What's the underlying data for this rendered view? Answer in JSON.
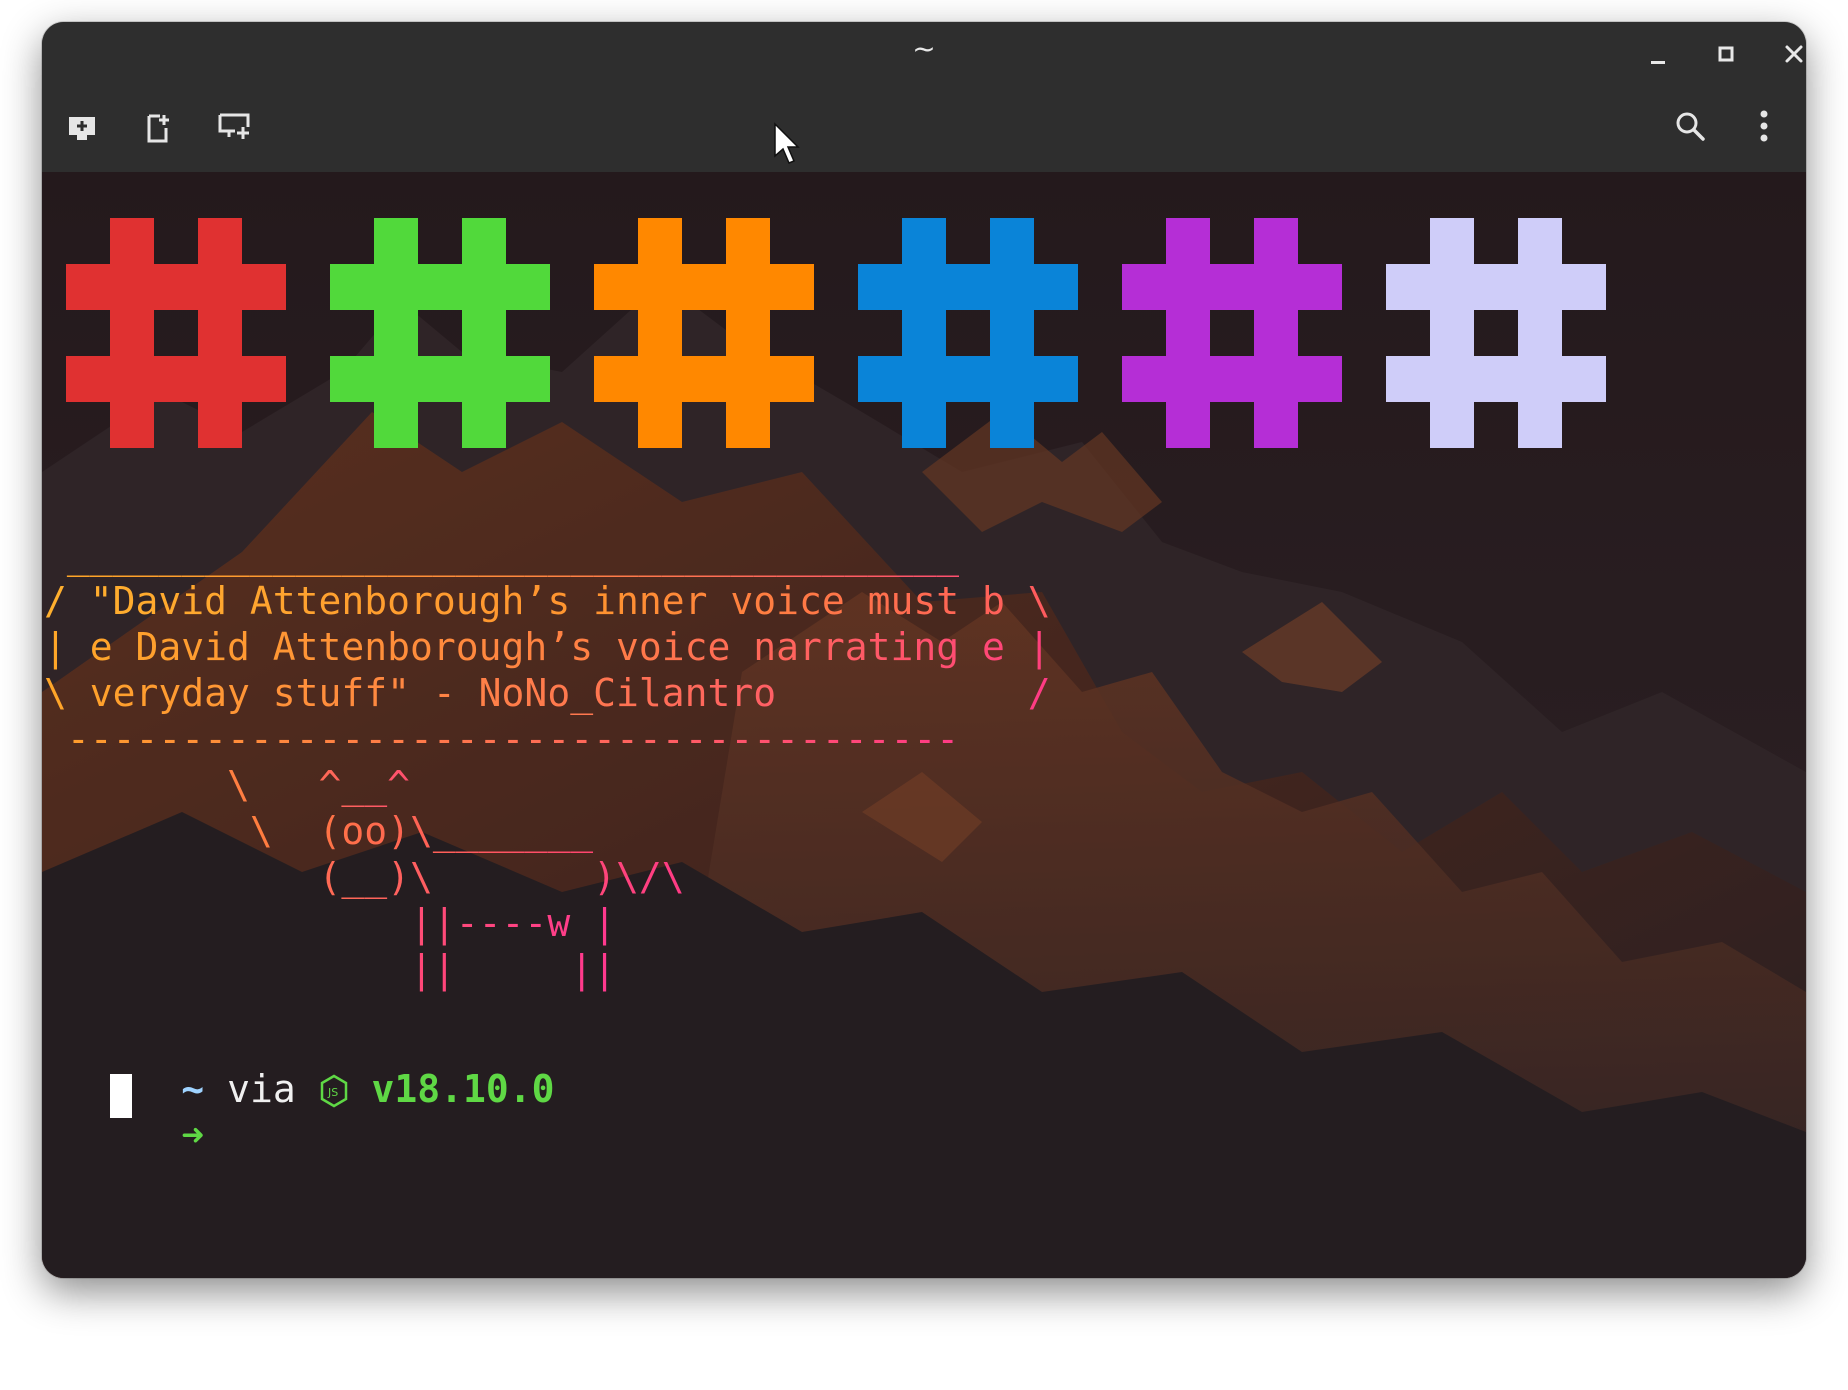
{
  "window": {
    "title": "~"
  },
  "toolbar": {
    "left_icons": [
      "new-tab-icon",
      "new-window-icon",
      "split-terminal-icon"
    ],
    "right_icons": [
      "search-icon",
      "kebab-menu-icon"
    ],
    "window_controls": [
      "minimize-icon",
      "maximize-icon",
      "close-icon"
    ]
  },
  "colors": {
    "swatch_red": "#e03131",
    "swatch_green": "#51d93b",
    "swatch_orange": "#ff8800",
    "swatch_blue": "#0a84d8",
    "swatch_purple": "#b52ed6",
    "swatch_lavender": "#cfcdf9",
    "prompt_green": "#5fd845"
  },
  "terminal": {
    "color_swatches": [
      "red",
      "green",
      "orange",
      "blue",
      "purple",
      "lavender"
    ],
    "bubble_top": " _______________________________________",
    "bubble_line1": "/ \"David Attenborough’s inner voice must b \\",
    "bubble_line2": "| e David Attenborough’s voice narrating e |",
    "bubble_line3": "\\ veryday stuff\" - NoNo_Cilantro           /",
    "bubble_bottom": " ---------------------------------------",
    "cow_line1": "        \\   ^__^",
    "cow_line2": "         \\  (oo)\\_______",
    "cow_line3": "            (__)\\       )\\/\\",
    "cow_line4": "                ||----w |",
    "cow_line5": "                ||     ||",
    "prompt": {
      "dir": "~",
      "via": "via",
      "node_icon": "nodejs-icon",
      "node_version": "v18.10.0",
      "arrow": "➜"
    }
  }
}
